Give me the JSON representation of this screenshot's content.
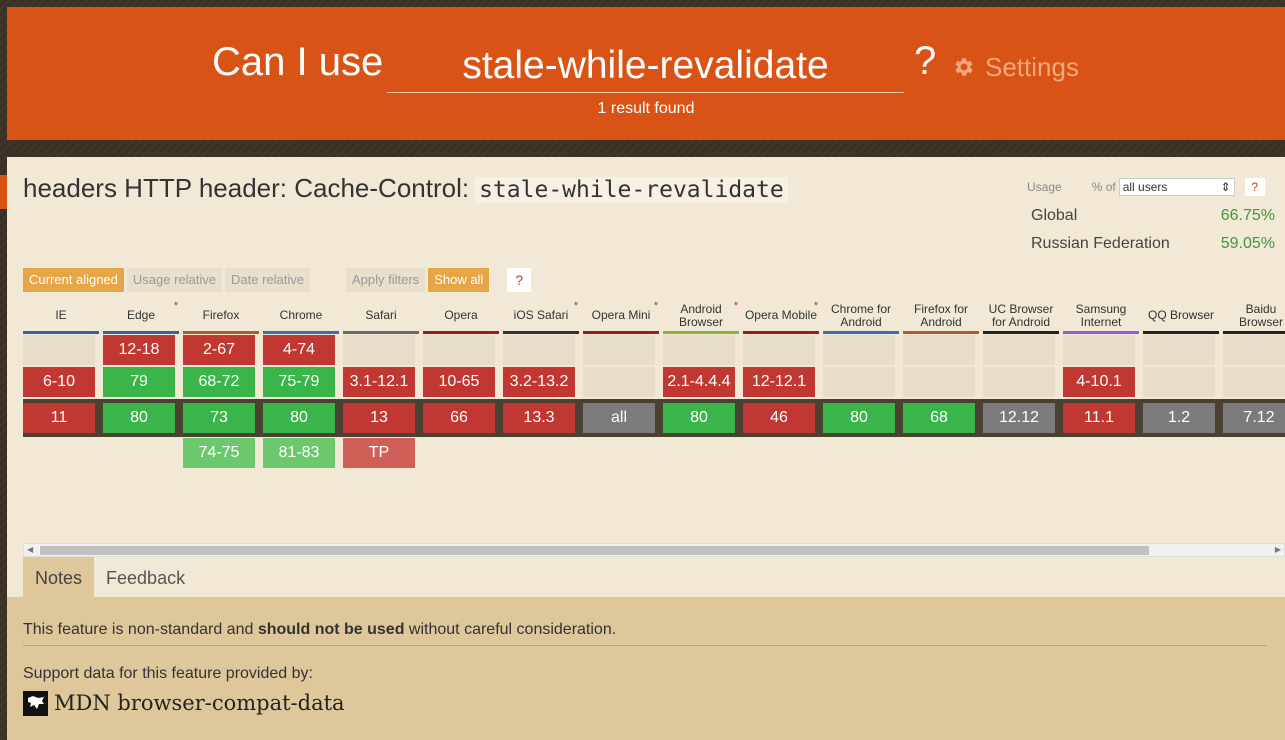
{
  "header": {
    "prefix": "Can I use",
    "search_value": "stale-while-revalidate",
    "qmark": "?",
    "settings_label": "Settings",
    "results": "1 result found"
  },
  "feature": {
    "title": "headers HTTP header: Cache-Control:",
    "code": "stale-while-revalidate"
  },
  "usage": {
    "label": "Usage",
    "pct_of": "% of",
    "select_value": "all users",
    "help": "?",
    "rows": [
      {
        "name": "Global",
        "value": "66.75%"
      },
      {
        "name": "Russian Federation",
        "value": "59.05%"
      }
    ]
  },
  "filters": {
    "current_aligned": "Current aligned",
    "usage_relative": "Usage relative",
    "date_relative": "Date relative",
    "apply_filters": "Apply filters",
    "show_all": "Show all",
    "help": "?"
  },
  "browsers": [
    {
      "name": "IE",
      "star": "",
      "bar": "#3b5fa5",
      "cells": [
        null,
        {
          "t": "6-10",
          "c": "red"
        },
        {
          "t": "11",
          "c": "red"
        },
        null
      ]
    },
    {
      "name": "Edge",
      "star": "*",
      "bar": "#3b5fa5",
      "cells": [
        {
          "t": "12-18",
          "c": "red"
        },
        {
          "t": "79",
          "c": "green"
        },
        {
          "t": "80",
          "c": "green"
        },
        null
      ]
    },
    {
      "name": "Firefox",
      "star": "",
      "bar": "#b05a2c",
      "cells": [
        {
          "t": "2-67",
          "c": "red"
        },
        {
          "t": "68-72",
          "c": "green"
        },
        {
          "t": "73",
          "c": "green"
        },
        {
          "t": "74-75",
          "c": "lightgreen"
        }
      ]
    },
    {
      "name": "Chrome",
      "star": "",
      "bar": "#3b6fb5",
      "cells": [
        {
          "t": "4-74",
          "c": "red"
        },
        {
          "t": "75-79",
          "c": "green"
        },
        {
          "t": "80",
          "c": "green"
        },
        {
          "t": "81-83",
          "c": "lightgreen"
        }
      ]
    },
    {
      "name": "Safari",
      "star": "",
      "bar": "#6b6b6b",
      "cells": [
        null,
        {
          "t": "3.1-12.1",
          "c": "red"
        },
        {
          "t": "13",
          "c": "red"
        },
        {
          "t": "TP",
          "c": "lightred"
        }
      ]
    },
    {
      "name": "Opera",
      "star": "",
      "bar": "#9a1e1e",
      "cells": [
        null,
        {
          "t": "10-65",
          "c": "red"
        },
        {
          "t": "66",
          "c": "red"
        },
        null
      ]
    },
    {
      "name": "iOS Safari",
      "star": "*",
      "bar": "#333333",
      "cells": [
        null,
        {
          "t": "3.2-13.2",
          "c": "red"
        },
        {
          "t": "13.3",
          "c": "red"
        },
        null
      ]
    },
    {
      "name": "Opera Mini",
      "star": "*",
      "bar": "#9a1e1e",
      "cells": [
        null,
        null,
        {
          "t": "all",
          "c": "gray"
        },
        null
      ]
    },
    {
      "name": "Android Browser",
      "star": "*",
      "bar": "#8cb33b",
      "cells": [
        null,
        {
          "t": "2.1-4.4.4",
          "c": "red"
        },
        {
          "t": "80",
          "c": "green"
        },
        null
      ]
    },
    {
      "name": "Opera Mobile",
      "star": "*",
      "bar": "#9a1e1e",
      "cells": [
        null,
        {
          "t": "12-12.1",
          "c": "red"
        },
        {
          "t": "46",
          "c": "red"
        },
        null
      ]
    },
    {
      "name": "Chrome for Android",
      "star": "",
      "bar": "#3b6fb5",
      "cells": [
        null,
        null,
        {
          "t": "80",
          "c": "green"
        },
        null
      ]
    },
    {
      "name": "Firefox for Android",
      "star": "",
      "bar": "#b05a2c",
      "cells": [
        null,
        null,
        {
          "t": "68",
          "c": "green"
        },
        null
      ]
    },
    {
      "name": "UC Browser for Android",
      "star": "",
      "bar": "#222222",
      "cells": [
        null,
        null,
        {
          "t": "12.12",
          "c": "gray"
        },
        null
      ]
    },
    {
      "name": "Samsung Internet",
      "star": "",
      "bar": "#9b59d6",
      "cells": [
        null,
        {
          "t": "4-10.1",
          "c": "red"
        },
        {
          "t": "11.1",
          "c": "red"
        },
        null
      ]
    },
    {
      "name": "QQ Browser",
      "star": "",
      "bar": "#222222",
      "cells": [
        null,
        null,
        {
          "t": "1.2",
          "c": "gray"
        },
        null
      ]
    },
    {
      "name": "Baidu Browser",
      "star": "",
      "bar": "#222222",
      "cells": [
        null,
        null,
        {
          "t": "7.12",
          "c": "gray"
        },
        null
      ]
    }
  ],
  "tabs": {
    "notes": "Notes",
    "feedback": "Feedback"
  },
  "notes": {
    "pre": "This feature is non-standard and ",
    "bold": "should not be used",
    "post": " without careful consideration.",
    "support": "Support data for this feature provided by:",
    "mdn": "MDN browser-compat-data"
  }
}
